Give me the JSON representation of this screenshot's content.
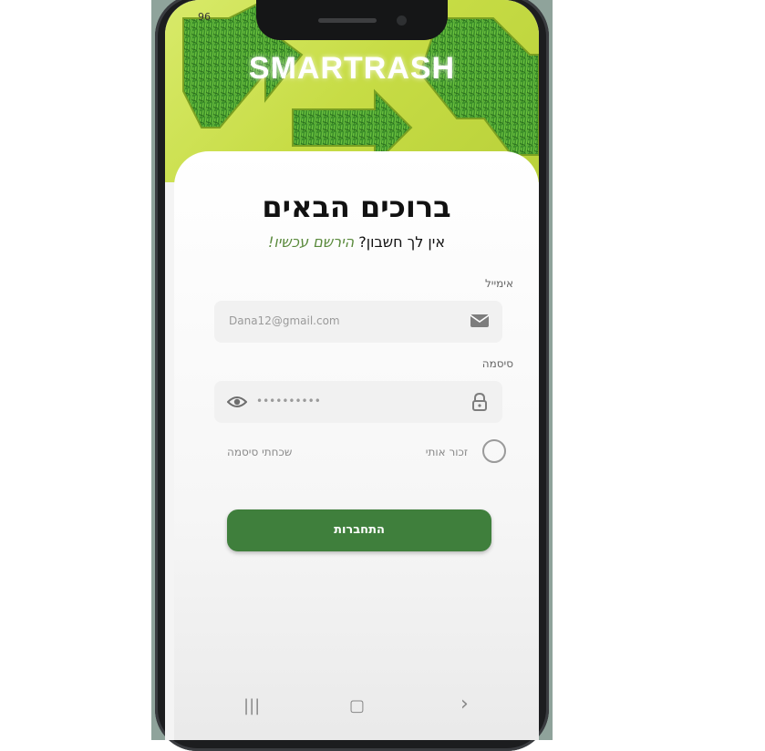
{
  "status": {
    "battery": "96"
  },
  "brand": {
    "name": "SMARTRASH"
  },
  "login": {
    "title": "ברוכים הבאים",
    "no_account": "אין לך חשבון?",
    "register_link": "הירשם עכשיו!",
    "email_label": "אימייל",
    "email_value": "Dana12@gmail.com",
    "password_label": "סיסמה",
    "password_value": "••••••••••",
    "remember_me": "זכור אותי",
    "forgot_password": "שכחתי סיסמה",
    "submit": "התחברות"
  },
  "navbar": {
    "recents": "|||",
    "home": "▢",
    "back": "›"
  },
  "icons": {
    "mail": "mail-icon",
    "lock": "lock-icon",
    "eye": "eye-icon"
  },
  "colors": {
    "primary": "#3f7f3c",
    "hero": "#c7dc45",
    "link": "#5a8a3c"
  }
}
